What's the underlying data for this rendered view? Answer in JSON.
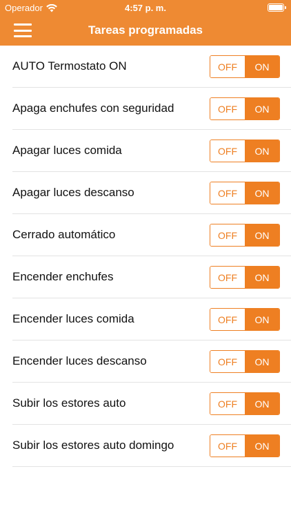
{
  "status_bar": {
    "carrier": "Operador",
    "time": "4:57 p. m.",
    "icons": [
      "wifi-icon",
      "battery-icon"
    ]
  },
  "nav": {
    "title": "Tareas programadas",
    "menu_icon": "hamburger-menu-icon"
  },
  "colors": {
    "accent": "#ee8a33",
    "toggle_accent": "#ee7f22"
  },
  "tasks": [
    {
      "label": "AUTO Termostato ON",
      "off": "OFF",
      "on": "ON",
      "state": "ON"
    },
    {
      "label": "Apaga enchufes con seguridad",
      "off": "OFF",
      "on": "ON",
      "state": "ON"
    },
    {
      "label": "Apagar luces comida",
      "off": "OFF",
      "on": "ON",
      "state": "ON"
    },
    {
      "label": "Apagar luces descanso",
      "off": "OFF",
      "on": "ON",
      "state": "ON"
    },
    {
      "label": "Cerrado automático",
      "off": "OFF",
      "on": "ON",
      "state": "ON"
    },
    {
      "label": "Encender enchufes",
      "off": "OFF",
      "on": "ON",
      "state": "ON"
    },
    {
      "label": "Encender luces comida",
      "off": "OFF",
      "on": "ON",
      "state": "ON"
    },
    {
      "label": "Encender luces descanso",
      "off": "OFF",
      "on": "ON",
      "state": "ON"
    },
    {
      "label": "Subir los estores auto",
      "off": "OFF",
      "on": "ON",
      "state": "ON"
    },
    {
      "label": "Subir los estores auto domingo",
      "off": "OFF",
      "on": "ON",
      "state": "ON"
    }
  ]
}
